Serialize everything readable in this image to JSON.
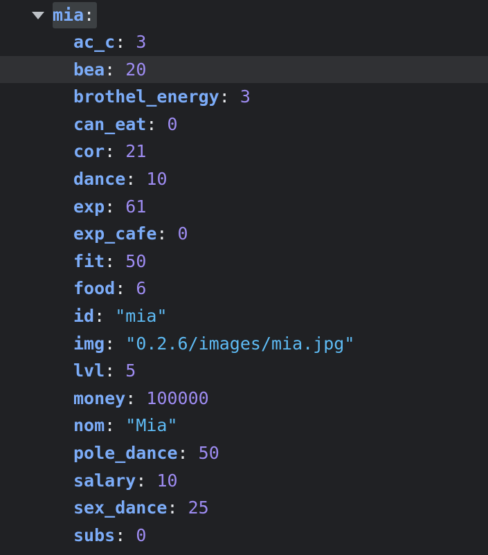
{
  "root": {
    "key": "mia",
    "colon": ":",
    "expanded": true
  },
  "entries": [
    {
      "key": "ac_c",
      "value": "3",
      "type": "number"
    },
    {
      "key": "bea",
      "value": "20",
      "type": "number",
      "highlighted": true
    },
    {
      "key": "brothel_energy",
      "value": "3",
      "type": "number"
    },
    {
      "key": "can_eat",
      "value": "0",
      "type": "number"
    },
    {
      "key": "cor",
      "value": "21",
      "type": "number"
    },
    {
      "key": "dance",
      "value": "10",
      "type": "number"
    },
    {
      "key": "exp",
      "value": "61",
      "type": "number"
    },
    {
      "key": "exp_cafe",
      "value": "0",
      "type": "number"
    },
    {
      "key": "fit",
      "value": "50",
      "type": "number"
    },
    {
      "key": "food",
      "value": "6",
      "type": "number"
    },
    {
      "key": "id",
      "value": "\"mia\"",
      "type": "string"
    },
    {
      "key": "img",
      "value": "\"0.2.6/images/mia.jpg\"",
      "type": "string"
    },
    {
      "key": "lvl",
      "value": "5",
      "type": "number"
    },
    {
      "key": "money",
      "value": "100000",
      "type": "number"
    },
    {
      "key": "nom",
      "value": "\"Mia\"",
      "type": "string"
    },
    {
      "key": "pole_dance",
      "value": "50",
      "type": "number"
    },
    {
      "key": "salary",
      "value": "10",
      "type": "number"
    },
    {
      "key": "sex_dance",
      "value": "25",
      "type": "number"
    },
    {
      "key": "subs",
      "value": "0",
      "type": "number"
    }
  ],
  "colors": {
    "background": "#202124",
    "highlight_row": "#303134",
    "key": "#7cacf8",
    "number": "#9e8cf2",
    "string": "#5ebbf4",
    "punctuation": "#e8eaed"
  },
  "icons": {
    "toggle": "triangle-down-icon"
  }
}
